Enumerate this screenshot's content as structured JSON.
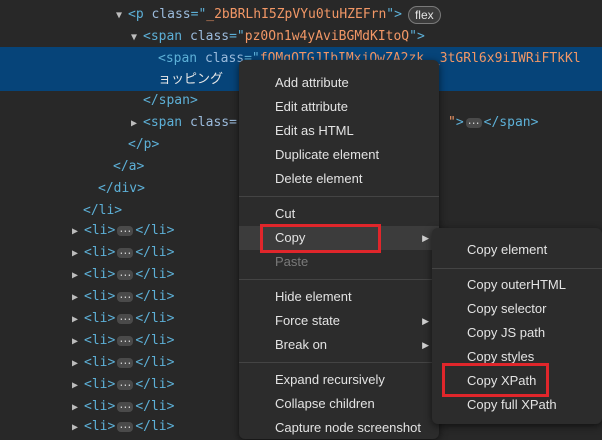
{
  "tree": {
    "l1": {
      "open": "<p ",
      "attr": "class",
      "eq": "=\"",
      "value": "_2bBRLhI5ZpVYu0tuHZEFrn",
      "close": "\">",
      "badge": "flex"
    },
    "l2": {
      "open": "<span ",
      "attr": "class",
      "eq": "=\"",
      "value": "pz0On1w4yAviBGMdKItoQ",
      "close": "\">"
    },
    "l3": {
      "open": "<span ",
      "attr": "class",
      "eq": "=\"",
      "value": "fOMqOTGJIbIMxjQwZA2zk _3tGRl6x9iIWRiFTkKl"
    },
    "l4": {
      "text": "ョッピング"
    },
    "l5": {
      "text": "</span>"
    },
    "l6": {
      "open": "<span ",
      "attr": "class=",
      "tail_quote": "\"",
      "after": "</span>"
    },
    "l7": {
      "text": "</p>"
    },
    "l8": {
      "text": "</a>"
    },
    "l9": {
      "text": "</div>"
    },
    "l10": {
      "text": "</li>"
    },
    "li_open": "<li>",
    "li_close": "</li>"
  },
  "context_menu": {
    "add_attribute": "Add attribute",
    "edit_attribute": "Edit attribute",
    "edit_html": "Edit as HTML",
    "duplicate": "Duplicate element",
    "delete": "Delete element",
    "cut": "Cut",
    "copy": "Copy",
    "paste": "Paste",
    "hide": "Hide element",
    "force_state": "Force state",
    "break_on": "Break on",
    "expand": "Expand recursively",
    "collapse": "Collapse children",
    "capture": "Capture node screenshot"
  },
  "copy_submenu": {
    "copy_element": "Copy element",
    "copy_outer_html": "Copy outerHTML",
    "copy_selector": "Copy selector",
    "copy_js_path": "Copy JS path",
    "copy_styles": "Copy styles",
    "copy_xpath": "Copy XPath",
    "copy_full_xpath": "Copy full XPath"
  },
  "colors": {
    "highlight": "#e0262b",
    "selection": "#064479"
  }
}
